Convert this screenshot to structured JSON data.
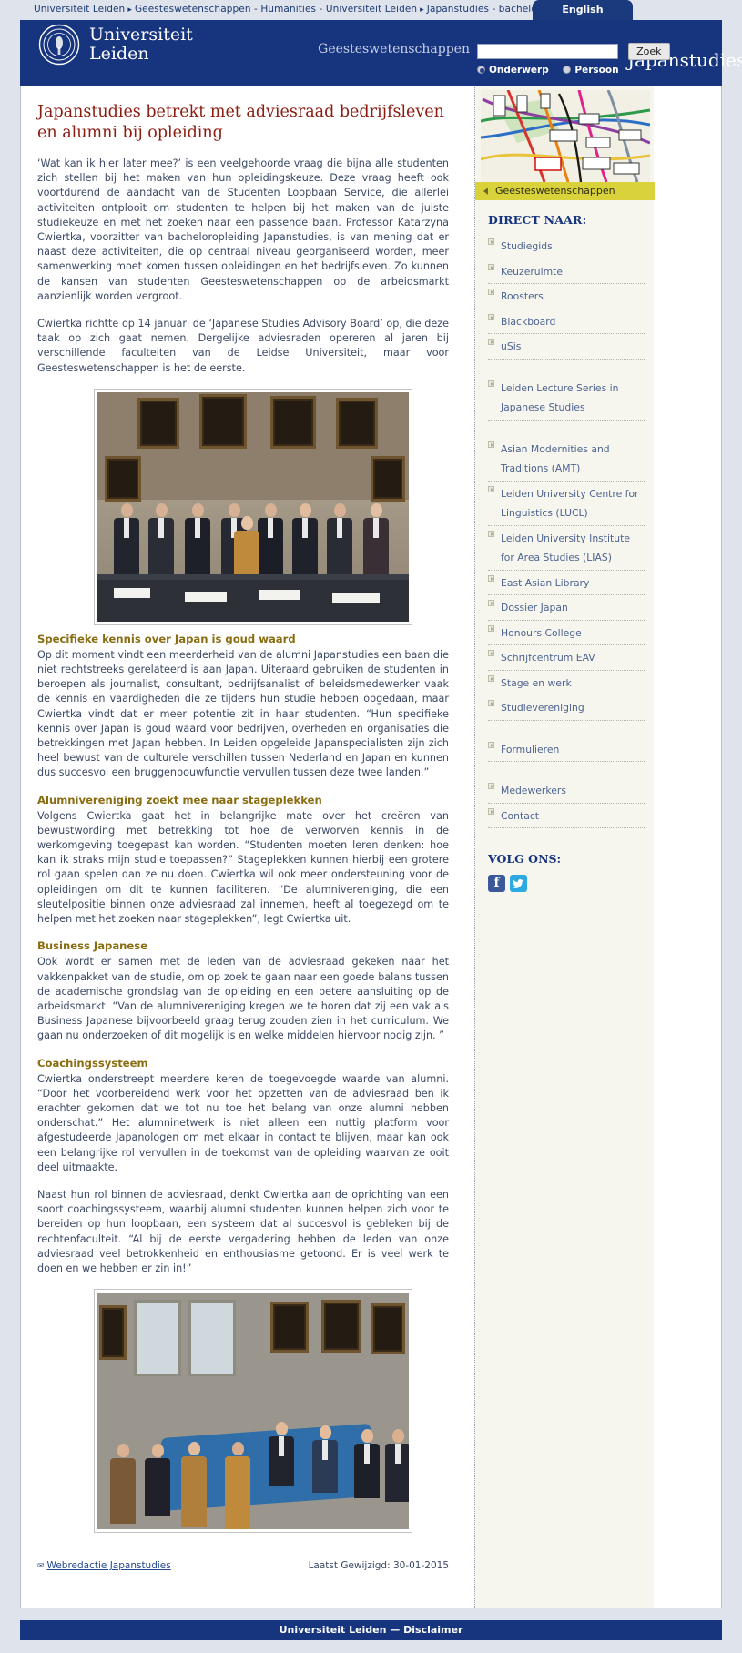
{
  "topbar": {
    "breadcrumb": [
      {
        "label": "Universiteit Leiden"
      },
      {
        "label": "Geesteswetenschappen - Humanities - Universiteit Leiden"
      },
      {
        "label": "Japanstudies - bacheloropleiding"
      }
    ],
    "separator": "▸",
    "language_tab": "English"
  },
  "header": {
    "logo_line1": "Universiteit",
    "logo_line2": "Leiden",
    "unit_title": "Japanstudies",
    "unit_subtitle": "Geesteswetenschappen",
    "search": {
      "value": "",
      "placeholder": "",
      "button_label": "Zoek",
      "options": [
        {
          "label": "Onderwerp",
          "selected": true
        },
        {
          "label": "Persoon",
          "selected": false
        }
      ]
    },
    "bg_color": "#17357f"
  },
  "article": {
    "title": "Japanstudies betrekt met adviesraad bedrijfsleven en alumni bij opleiding",
    "title_color": "#8b1c10",
    "intro_paragraphs": [
      "‘Wat kan ik hier later mee?’ is een veelgehoorde vraag die bijna alle studenten zich stellen bij het maken van hun opleidingskeuze. Deze vraag heeft ook voortdurend de aandacht van de Studenten Loopbaan Service, die allerlei activiteiten ontplooit om studenten te helpen bij het maken van de juiste studiekeuze en met het zoeken naar een passende baan. Professor Katarzyna Cwiertka, voorzitter van bacheloropleiding Japanstudies, is van mening dat er naast deze activiteiten, die op centraal niveau georganiseerd worden, meer samenwerking moet komen tussen opleidingen en het bedrijfsleven. Zo kunnen de kansen van studenten Geesteswetenschappen op de arbeidsmarkt aanzienlijk worden vergroot.",
      "Cwiertka richtte op 14 januari de ‘Japanese Studies Advisory Board’ op, die deze taak op zich gaat nemen. Dergelijke adviesraden opereren al jaren bij verschillende faculteiten van de Leidse Universiteit, maar voor Geesteswetenschappen is het de eerste."
    ],
    "photo_1": {
      "alt": "Leden van de Japanese Studies Advisory Board poseren in een vergaderzaal"
    },
    "photo_2": {
      "alt": "Vergadering van de adviesraad rond een blauwe tafel"
    },
    "sections": [
      {
        "heading": "Specifieke kennis over Japan is goud waard",
        "body": "Op dit moment vindt een meerderheid van de alumni Japanstudies een baan die niet rechtstreeks gerelateerd is aan Japan. Uiteraard gebruiken de studenten in beroepen als journalist, consultant, bedrijfsanalist of beleidsmedewerker vaak de kennis en vaardigheden die ze tijdens hun studie hebben opgedaan, maar Cwiertka vindt dat er meer potentie zit in haar studenten. “Hun specifieke kennis over Japan is goud waard voor bedrijven, overheden en organisaties die betrekkingen met Japan hebben. In Leiden opgeleide Japanspecialisten zijn zich heel bewust van de culturele verschillen tussen Nederland en Japan en kunnen dus succesvol een bruggenbouwfunctie vervullen tussen deze twee landen.”"
      },
      {
        "heading": "Alumnivereniging zoekt mee naar stageplekken",
        "body": "Volgens Cwiertka gaat het in belangrijke mate over het creëren van bewustwording met betrekking tot hoe de verworven kennis in de werkomgeving toegepast kan worden. “Studenten moeten leren denken: hoe kan ik straks mijn studie toepassen?” Stageplekken kunnen hierbij een grotere rol gaan spelen dan ze nu doen. Cwiertka wil ook meer ondersteuning voor de opleidingen om dit te kunnen faciliteren. “De alumnivereniging, die een sleutelpositie binnen onze adviesraad zal innemen, heeft al toegezegd om te helpen met het zoeken naar stageplekken”, legt Cwiertka uit."
      },
      {
        "heading": "Business Japanese",
        "body": "Ook wordt er samen met de leden van de adviesraad gekeken naar het vakkenpakket van de studie, om op zoek te gaan naar een goede balans tussen de academische grondslag van de opleiding en een betere aansluiting op de arbeidsmarkt. “Van de alumnivereniging kregen we te horen dat zij een vak als Business Japanese bijvoorbeeld graag terug zouden zien in het curriculum. We gaan nu onderzoeken of dit mogelijk is en welke middelen hiervoor nodig zijn. ”"
      },
      {
        "heading": "Coachingssysteem",
        "body": "Cwiertka onderstreept meerdere keren de toegevoegde waarde van alumni. “Door het voorbereidend werk voor het opzetten van de adviesraad ben ik erachter gekomen dat we tot nu toe het belang van onze alumni hebben onderschat.” Het alumninetwerk is niet alleen een nuttig platform voor afgestudeerde Japanologen om met elkaar in contact te blijven, maar kan ook een belangrijke rol vervullen in de toekomst van de opleiding waarvan ze ooit deel uitmaakte."
      }
    ],
    "closing_paragraph": "Naast hun rol binnen de adviesraad, denkt Cwiertka aan de oprichting van een soort coachingssysteem, waarbij alumni studenten kunnen helpen zich voor te bereiden op hun loopbaan, een systeem dat al succesvol is gebleken bij de rechtenfaculteit. “Al bij de eerste vergadering hebben de leden van onze adviesraad veel betrokkenheid en enthousiasme getoond. Er is veel werk te doen en we hebben er zin in!”"
  },
  "colophon": {
    "editor_link": "Webredactie Japanstudies",
    "mail_icon": "✉",
    "modified_label": "Laatst Gewijzigd: 30-01-2015"
  },
  "sidebar": {
    "metro_image_alt": "Kaart van het metronetwerk van Tokio",
    "faculty_bar": {
      "label": "Geesteswetenschappen",
      "bg_color": "#d9d23a"
    },
    "direct_heading": "DIRECT NAAR:",
    "groups": [
      {
        "items": [
          {
            "label": "Studiegids"
          },
          {
            "label": "Keuzeruimte"
          },
          {
            "label": "Roosters"
          },
          {
            "label": "Blackboard"
          },
          {
            "label": "uSis"
          }
        ]
      },
      {
        "items": [
          {
            "label": "Leiden Lecture Series in Japanese Studies"
          }
        ]
      },
      {
        "items": [
          {
            "label": "Asian Modernities and Traditions (AMT)"
          },
          {
            "label": "Leiden University Centre for Linguistics (LUCL)"
          },
          {
            "label": "Leiden University Institute for Area Studies (LIAS)"
          },
          {
            "label": "East Asian Library"
          },
          {
            "label": "Dossier Japan"
          },
          {
            "label": "Honours College"
          },
          {
            "label": "Schrijfcentrum EAV"
          },
          {
            "label": "Stage en werk"
          },
          {
            "label": "Studievereniging"
          }
        ]
      },
      {
        "items": [
          {
            "label": "Formulieren"
          }
        ]
      },
      {
        "items": [
          {
            "label": "Medewerkers"
          },
          {
            "label": "Contact"
          }
        ]
      }
    ],
    "follow_heading": "VOLG ONS:",
    "social": [
      {
        "name": "facebook",
        "glyph": "f"
      },
      {
        "name": "twitter",
        "glyph": "ᵛ"
      }
    ]
  },
  "footer": {
    "text": "Universiteit Leiden — Disclaimer",
    "bg_color": "#17357f"
  }
}
